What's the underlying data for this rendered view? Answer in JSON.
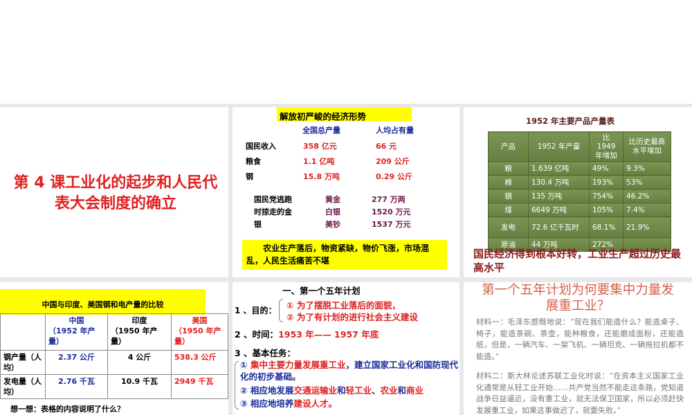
{
  "slide1": {
    "title": "第 4 课工业化的起步和人民代表大会制度的确立"
  },
  "slide2": {
    "title": "解放初严峻的经济形势",
    "headers": [
      "全国总产量",
      "人均占有量"
    ],
    "rows": [
      {
        "label": "国民收入",
        "total": "358 亿元",
        "per": "66 元"
      },
      {
        "label": "粮食",
        "total": "1.1 亿吨",
        "per": "209 公斤"
      },
      {
        "label": "钢",
        "total": "15.8 万吨",
        "per": "0.29 公斤"
      }
    ],
    "loot_label": "国民党逃跑时掠走的金银",
    "loot": [
      {
        "item": "黄金",
        "value": "277 万两"
      },
      {
        "item": "白银",
        "value": "1520 万元"
      },
      {
        "item": "美钞",
        "value": "1537 万元"
      }
    ],
    "summary": "农业生产落后，物资紧缺，物价飞涨，市场混乱，人民生活痛苦不堪"
  },
  "slide3": {
    "title": "1952 年主要产品产量表",
    "headers": [
      "产品",
      "1952 年产量",
      "比 1949 年增加",
      "比历史最高水平增加"
    ],
    "rows": [
      [
        "粮",
        "1.639 亿吨",
        "49%",
        "9.3%"
      ],
      [
        "棉",
        "130.4 万吨",
        "193%",
        "53%"
      ],
      [
        "钢",
        "135 万吨",
        "754%",
        "46.2%"
      ],
      [
        "煤",
        "6649 万吨",
        "105%",
        "7.4%"
      ],
      [
        "发电",
        "72.6 亿千瓦时",
        "68.1%",
        "21.9%"
      ],
      [
        "原油",
        "44 万吨",
        "272%",
        ""
      ]
    ],
    "conclusion": "国民经济得到根本好转，工业生产超过历史最高水平"
  },
  "slide4": {
    "title": "中国与印度、美国钢和电产量的比较",
    "headers": [
      {
        "name": "中国",
        "note": "（1952 年产量）"
      },
      {
        "name": "印度",
        "note": "（1950 年产量）"
      },
      {
        "name": "美国",
        "note": "（1950 年产量）"
      }
    ],
    "rows": [
      {
        "label": "钢产量（人均）",
        "values": [
          "2.37 公斤",
          "4 公斤",
          "538.3 公斤"
        ]
      },
      {
        "label": "发电量（人均）",
        "values": [
          "2.76 千瓦",
          "10.9 千瓦",
          "2949 千瓦"
        ]
      }
    ],
    "question": "想一想：表格的内容说明了什么？"
  },
  "slide5": {
    "title": "一、第一个五年计划",
    "purpose_label": "1 、目的：",
    "purposes": [
      "① 为了摆脱工业落后的面貌，",
      "② 为了有计划的进行社会主义建设"
    ],
    "time_label": "2 、时间：",
    "time_value": "1953 年—— 1957 年底",
    "tasks_label": "3 、基本任务：",
    "task1_num": "①",
    "task1_red": "集中主要力量发展重工业",
    "task1_blue": "，建立国家工业化和国防现代化的初步基础。",
    "task2_a": "② 相应地发展",
    "task2_b": "交通运输业",
    "task2_c": "和",
    "task2_d": "轻工业",
    "task2_e": "、",
    "task2_f": "农业",
    "task2_g": "和",
    "task2_h": "商业",
    "task3_a": "③ 相应地培养",
    "task3_b": "建设人才。"
  },
  "slide6": {
    "title": "第一个五年计划为何要集中力量发展重工业？",
    "material1": "材料一：毛泽东感慨地说：“现在我们能造什么？能造桌子、椅子，能造茶碗、茶壶，能种粮食，还能磨成面粉，还能造纸，但是，一辆汽车、一架飞机、一辆坦克、一辆拖拉机都不能造。”",
    "material2": "材料二：斯大林论述苏联工业化时说：“在资本主义国家工业化通常是从轻工业开始……共产党当然不能走这条路，党知道战争日益逼近，没有重工业，就无法保卫国家，所以必须赶快发展重工业，如果这事做迟了，就要失败。”"
  }
}
